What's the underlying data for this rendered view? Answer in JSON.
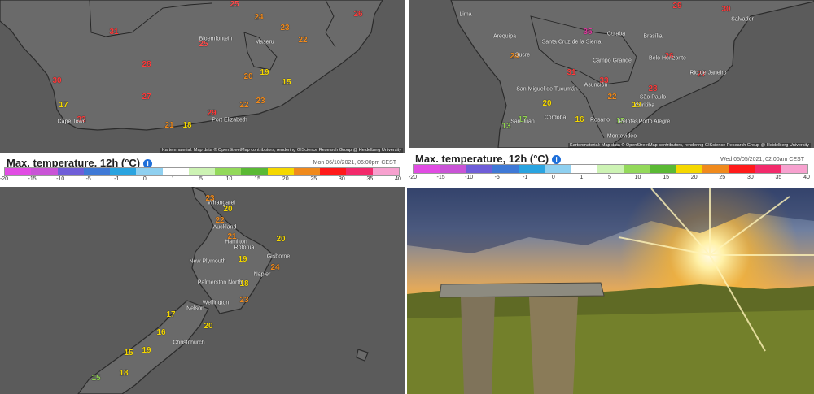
{
  "panels": {
    "south_africa": {
      "cities": [
        "Bloemfontein",
        "Maseru",
        "Cape Town",
        "Port Elizabeth"
      ],
      "temps": [
        {
          "v": "25",
          "c": "#ff4f4f"
        },
        {
          "v": "24",
          "c": "#f08a1c"
        },
        {
          "v": "23",
          "c": "#f08a1c"
        },
        {
          "v": "22",
          "c": "#f08a1c"
        },
        {
          "v": "26",
          "c": "#ff3c3c"
        },
        {
          "v": "31",
          "c": "#ff3c3c"
        },
        {
          "v": "28",
          "c": "#ff3c3c"
        },
        {
          "v": "25",
          "c": "#ff4f4f"
        },
        {
          "v": "19",
          "c": "#f5d800"
        },
        {
          "v": "20",
          "c": "#f08a1c"
        },
        {
          "v": "15",
          "c": "#f5d800"
        },
        {
          "v": "27",
          "c": "#ff3c3c"
        },
        {
          "v": "30",
          "c": "#ff3c3c"
        },
        {
          "v": "33",
          "c": "#ff3c3c"
        },
        {
          "v": "29",
          "c": "#ff3c3c"
        },
        {
          "v": "21",
          "c": "#f08a1c"
        },
        {
          "v": "18",
          "c": "#f5d800"
        },
        {
          "v": "17",
          "c": "#f5d800"
        },
        {
          "v": "22",
          "c": "#f08a1c"
        },
        {
          "v": "23",
          "c": "#f08a1c"
        }
      ],
      "attribution": "Kartenmaterial: Map data © OpenStreetMap contributors, rendering GIScience Research Group @ Heidelberg University",
      "legend": {
        "title": "Max. temperature, 12h (°C)",
        "date": "Mon 06/10/2021, 06:00pm CEST",
        "ticks": [
          "-20",
          "-15",
          "-10",
          "-5",
          "-1",
          "0",
          "1",
          "5",
          "10",
          "15",
          "20",
          "25",
          "30",
          "35",
          "40"
        ]
      }
    },
    "south_america": {
      "cities": [
        "Lima",
        "Arequipa",
        "Santa Cruz de la Sierra",
        "Sucre",
        "Cuiabá",
        "Brasília",
        "Campo Grande",
        "Belo Horizonte",
        "Rio de Janeiro",
        "São Paulo",
        "Curitiba",
        "Asunción",
        "San Miguel de Tucumán",
        "Córdoba",
        "Rosario",
        "Montevideo",
        "Pelotas",
        "Salvador",
        "Porto Alegre",
        "San Juan"
      ],
      "temps": [
        {
          "v": "29",
          "c": "#ff3c3c"
        },
        {
          "v": "30",
          "c": "#ff3c3c"
        },
        {
          "v": "24",
          "c": "#f08a1c"
        },
        {
          "v": "31",
          "c": "#ff3c3c"
        },
        {
          "v": "33",
          "c": "#ff3c3c"
        },
        {
          "v": "20",
          "c": "#f5d800"
        },
        {
          "v": "17",
          "c": "#8fd14f"
        },
        {
          "v": "13",
          "c": "#8fd14f"
        },
        {
          "v": "16",
          "c": "#f5d800"
        },
        {
          "v": "28",
          "c": "#ff3c3c"
        },
        {
          "v": "26",
          "c": "#ff3c3c"
        },
        {
          "v": "27",
          "c": "#ff3c3c"
        },
        {
          "v": "19",
          "c": "#f5d800"
        },
        {
          "v": "15",
          "c": "#8fd14f"
        },
        {
          "v": "22",
          "c": "#f08a1c"
        },
        {
          "v": "35",
          "c": "#e0389f"
        }
      ],
      "attribution": "Kartenmaterial: Map data © OpenStreetMap contributors, rendering GIScience Research Group @ Heidelberg University",
      "legend": {
        "title": "Max. temperature, 12h (°C)",
        "date": "Wed 05/05/2021, 02:00am CEST",
        "ticks": [
          "-20",
          "-15",
          "-10",
          "-5",
          "-1",
          "0",
          "1",
          "5",
          "10",
          "15",
          "20",
          "25",
          "30",
          "35",
          "40"
        ]
      }
    },
    "new_zealand": {
      "cities": [
        "Whangarei",
        "Auckland",
        "Hamilton",
        "Rotorua",
        "Gisborne",
        "New Plymouth",
        "Napier",
        "Palmerston North",
        "Wellington",
        "Nelson",
        "Christchurch"
      ],
      "temps": [
        {
          "v": "23",
          "c": "#f08a1c"
        },
        {
          "v": "20",
          "c": "#f5d800"
        },
        {
          "v": "22",
          "c": "#f08a1c"
        },
        {
          "v": "21",
          "c": "#f08a1c"
        },
        {
          "v": "20",
          "c": "#f5d800"
        },
        {
          "v": "19",
          "c": "#f5d800"
        },
        {
          "v": "24",
          "c": "#f08a1c"
        },
        {
          "v": "18",
          "c": "#f5d800"
        },
        {
          "v": "17",
          "c": "#f5d800"
        },
        {
          "v": "16",
          "c": "#f5d800"
        },
        {
          "v": "15",
          "c": "#f5d800"
        },
        {
          "v": "19",
          "c": "#f5d800"
        },
        {
          "v": "15",
          "c": "#8fd14f"
        },
        {
          "v": "18",
          "c": "#f5d800"
        },
        {
          "v": "20",
          "c": "#f5d800"
        },
        {
          "v": "23",
          "c": "#f08a1c"
        }
      ]
    }
  },
  "legend_colors": [
    "#e14ce3",
    "#c954d6",
    "#6f5ed8",
    "#3f79d6",
    "#2aa4e0",
    "#8fd0f0",
    "#ffffff",
    "#cdf3b4",
    "#93d95a",
    "#5ab934",
    "#f5d800",
    "#f08a1c",
    "#ff1a1a",
    "#f22a6b",
    "#f7a1cf"
  ]
}
